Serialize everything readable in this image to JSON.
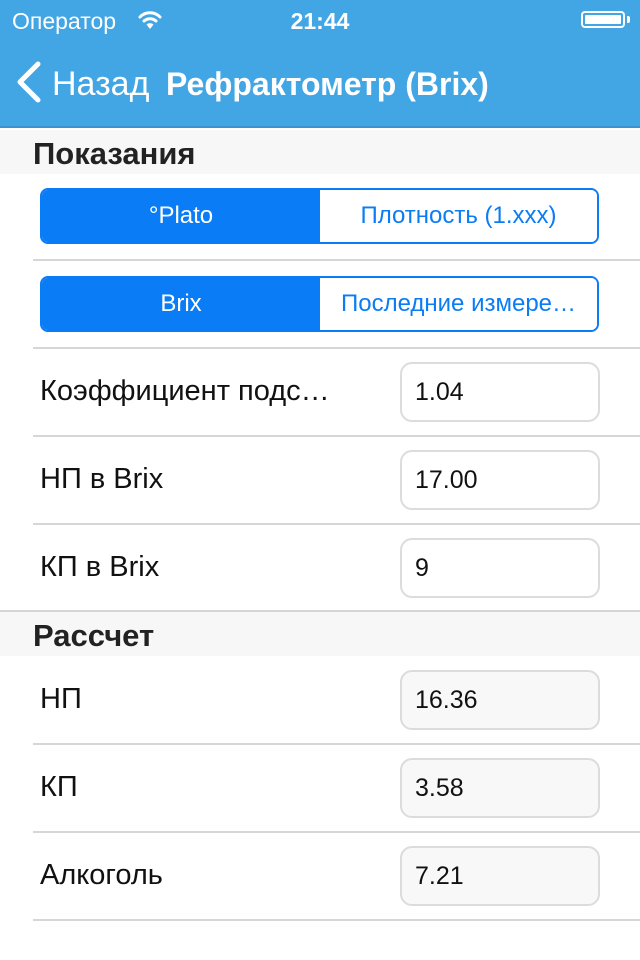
{
  "status_bar": {
    "carrier": "Оператор",
    "wifi_icon": "wifi-icon",
    "time": "21:44",
    "battery_icon": "battery-icon",
    "battery_level": 1.0
  },
  "nav_bar": {
    "back_icon": "chevron-left-icon",
    "back_label": "Назад",
    "title": "Рефрактометр (Brix)",
    "color": "#42a5e4"
  },
  "sections": {
    "readings": {
      "title": "Показания",
      "segment_units": {
        "options": [
          "°Plato",
          "Плотность (1.xxx)"
        ],
        "selected": 0
      },
      "segment_source": {
        "options": [
          "Brix",
          "Последние измере…"
        ],
        "selected": 0
      },
      "rows": [
        {
          "label": "Коэффициент подс…",
          "value": "1.04"
        },
        {
          "label": "НП в Brix",
          "value": "17.00"
        },
        {
          "label": "КП в Brix",
          "value": "9"
        }
      ]
    },
    "calculation": {
      "title": "Рассчет",
      "rows": [
        {
          "label": "НП",
          "value": "16.36"
        },
        {
          "label": "КП",
          "value": "3.58"
        },
        {
          "label": "Алкоголь",
          "value": "7.21"
        }
      ]
    }
  },
  "accent_color": "#0a7cf6"
}
